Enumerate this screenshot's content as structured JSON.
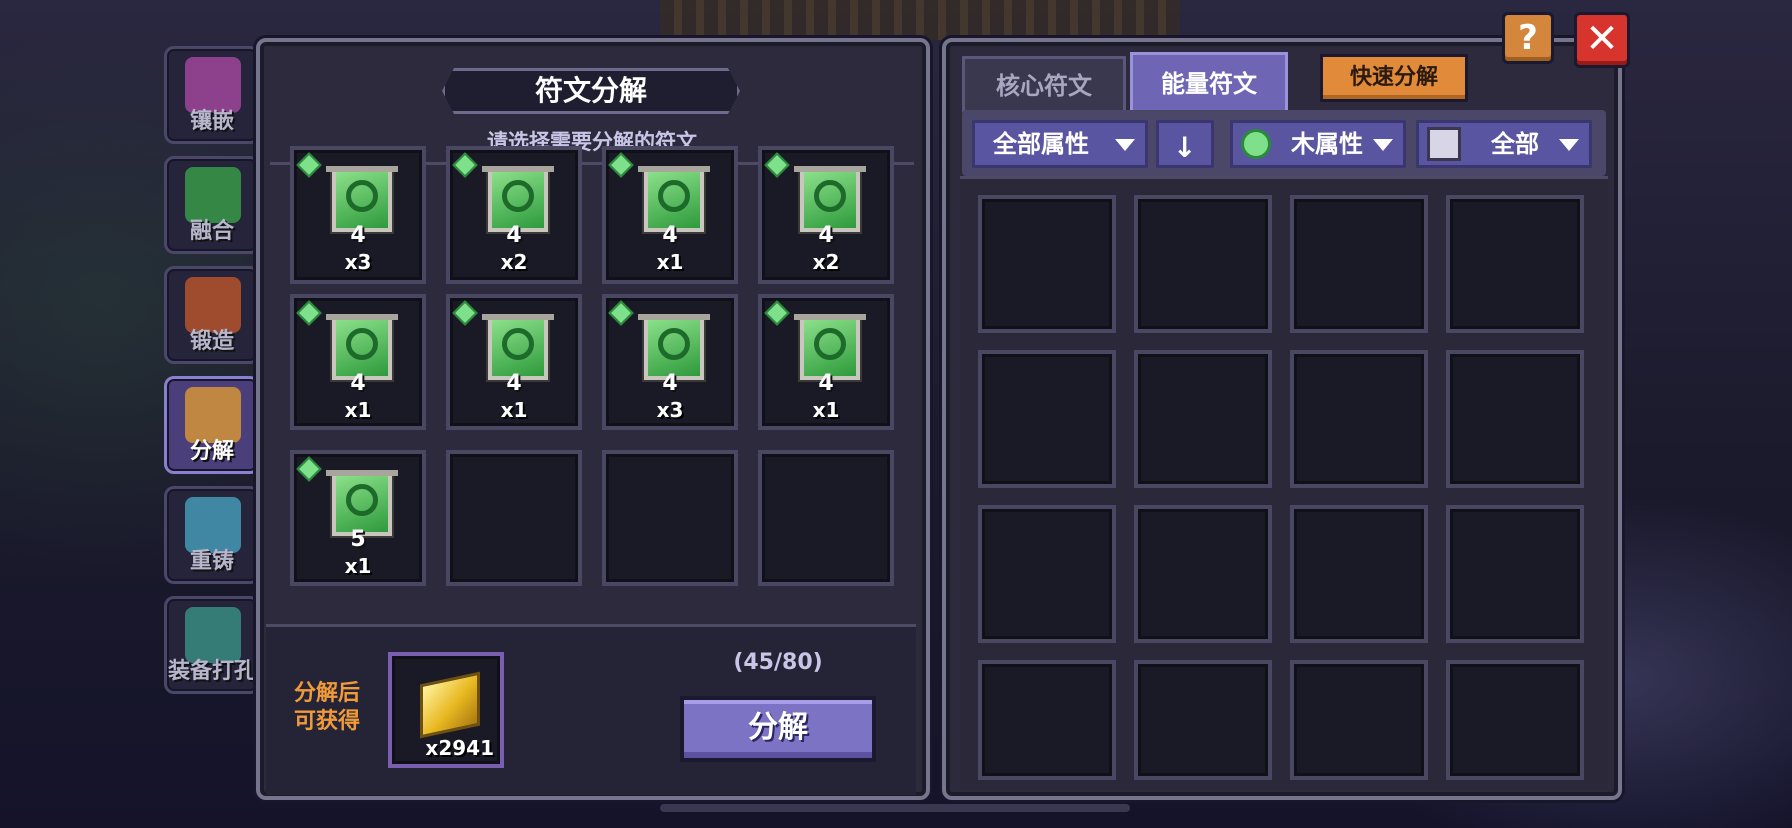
{
  "side_nav": [
    {
      "label": "镶嵌",
      "icon": "inlay-icon",
      "color": "#b04aa8"
    },
    {
      "label": "融合",
      "icon": "fusion-icon",
      "color": "#3aa84a"
    },
    {
      "label": "锻造",
      "icon": "forge-icon",
      "color": "#c8582a"
    },
    {
      "label": "分解",
      "icon": "decompose-icon",
      "color": "#e8a030",
      "active": true
    },
    {
      "label": "重铸",
      "icon": "recast-icon",
      "color": "#4aa8c8"
    },
    {
      "label": "装备打孔",
      "icon": "drill-icon",
      "color": "#3a9a8a"
    }
  ],
  "left": {
    "title": "符文分解",
    "subtitle": "请选择需要分解的符文",
    "runes": [
      {
        "level": "4",
        "qty": "x3"
      },
      {
        "level": "4",
        "qty": "x2"
      },
      {
        "level": "4",
        "qty": "x1"
      },
      {
        "level": "4",
        "qty": "x2"
      },
      {
        "level": "4",
        "qty": "x1"
      },
      {
        "level": "4",
        "qty": "x1"
      },
      {
        "level": "4",
        "qty": "x3"
      },
      {
        "level": "4",
        "qty": "x1"
      },
      {
        "level": "5",
        "qty": "x1"
      }
    ],
    "reward_label_line1": "分解后",
    "reward_label_line2": "可获得",
    "reward_qty": "x2941",
    "capacity": "(45/80)",
    "decompose_button": "分解"
  },
  "right": {
    "tabs": [
      "核心符文",
      "能量符文"
    ],
    "active_tab": "能量符文",
    "quick_decompose": "快速分解",
    "filters": {
      "attribute": "全部属性",
      "element": "木属性",
      "category": "全部"
    }
  },
  "top_buttons": {
    "help": "?",
    "close": "✕"
  },
  "colors": {
    "accent_purple": "#7c73c4",
    "quick_orange": "#e08a3a",
    "close_red": "#d8342e",
    "wood_green": "#7ee08a"
  }
}
